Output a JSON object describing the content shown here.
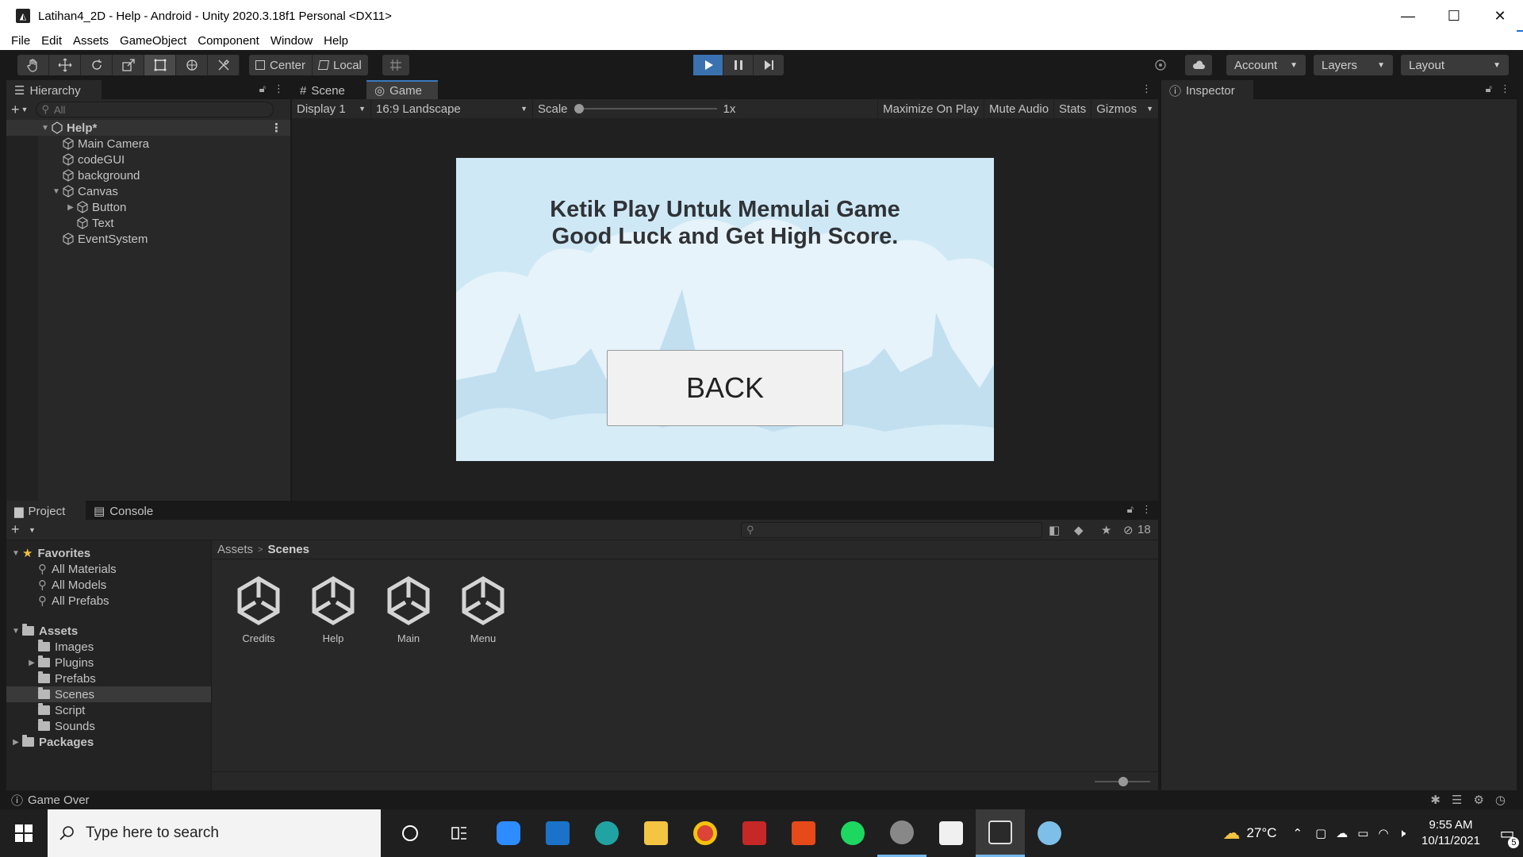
{
  "window": {
    "title": "Latihan4_2D - Help - Android - Unity 2020.3.18f1 Personal <DX11>",
    "minimize": "—",
    "maximize": "☐",
    "close": "✕"
  },
  "menu": [
    "File",
    "Edit",
    "Assets",
    "GameObject",
    "Component",
    "Window",
    "Help"
  ],
  "toolbar": {
    "pivot_center": "Center",
    "pivot_local": "Local",
    "account": "Account",
    "layers": "Layers",
    "layout": "Layout",
    "play_state": "playing"
  },
  "hierarchy": {
    "tab": "Hierarchy",
    "search_placeholder": "All",
    "scene": "Help*",
    "items": [
      "Main Camera",
      "codeGUI",
      "background",
      "Canvas",
      "Button",
      "Text",
      "EventSystem"
    ]
  },
  "game": {
    "tab_scene": "Scene",
    "tab_game": "Game",
    "display": "Display 1",
    "aspect": "16:9 Landscape",
    "scale_label": "Scale",
    "scale_value": "1x",
    "maximize_on_play": "Maximize On Play",
    "mute_audio": "Mute Audio",
    "stats": "Stats",
    "gizmos": "Gizmos",
    "title_line1": "Ketik Play Untuk Memulai Game",
    "title_line2": "Good Luck and Get High Score.",
    "back_button": "BACK",
    "sky_color": "#cfe8f5"
  },
  "inspector": {
    "tab": "Inspector"
  },
  "project": {
    "tab_project": "Project",
    "tab_console": "Console",
    "hidden_count": "18",
    "favorites_label": "Favorites",
    "favorites": [
      "All Materials",
      "All Models",
      "All Prefabs"
    ],
    "assets_label": "Assets",
    "folders": [
      "Images",
      "Plugins",
      "Prefabs",
      "Scenes",
      "Script",
      "Sounds"
    ],
    "packages_label": "Packages",
    "breadcrumb_root": "Assets",
    "breadcrumb_current": "Scenes",
    "scene_assets": [
      "Credits",
      "Help",
      "Main",
      "Menu"
    ]
  },
  "status": {
    "message": "Game Over"
  },
  "taskbar": {
    "search_placeholder": "Type here to search",
    "temperature": "27°C",
    "time": "9:55 AM",
    "date": "10/11/2021",
    "notifications": "5"
  },
  "colors": {
    "accent": "#3a72b0",
    "unity_bg": "#282828",
    "taskbar": "#1f1f1f"
  }
}
